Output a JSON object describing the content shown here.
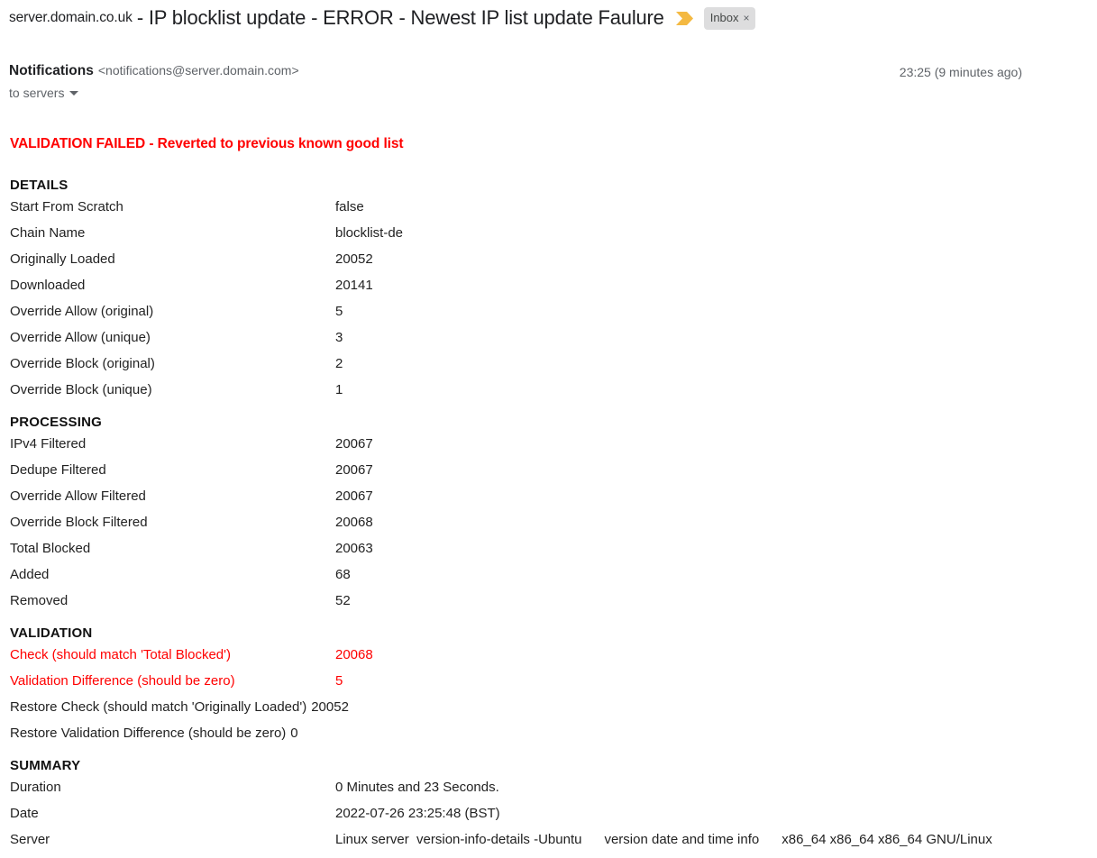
{
  "subject": {
    "sender_domain": "server.domain.co.uk",
    "title": "- IP blocklist update - ERROR - Newest IP list update Faulure",
    "flag_icon": "flag-icon",
    "label_chip": "Inbox",
    "label_chip_close": "×"
  },
  "header": {
    "sender_name": "Notifications",
    "sender_email": "<notifications@server.domain.com>",
    "timestamp": "23:25 (9 minutes ago)",
    "recipient": "to servers",
    "recipient_caret": "chevron-down-icon"
  },
  "body": {
    "alert": "VALIDATION FAILED - Reverted to previous known good list",
    "sections": [
      {
        "title": "DETAILS",
        "rows": [
          {
            "label": "Start From Scratch",
            "value": "false",
            "error": false
          },
          {
            "label": "Chain Name",
            "value": "blocklist-de",
            "error": false
          },
          {
            "label": "Originally Loaded",
            "value": "20052",
            "error": false
          },
          {
            "label": "Downloaded",
            "value": "20141",
            "error": false
          },
          {
            "label": "Override Allow (original)",
            "value": "5",
            "error": false
          },
          {
            "label": "Override Allow (unique)",
            "value": "3",
            "error": false
          },
          {
            "label": "Override Block (original)",
            "value": "2",
            "error": false
          },
          {
            "label": "Override Block (unique)",
            "value": "1",
            "error": false
          }
        ]
      },
      {
        "title": "PROCESSING",
        "rows": [
          {
            "label": "IPv4 Filtered",
            "value": "20067",
            "error": false
          },
          {
            "label": "Dedupe Filtered",
            "value": "20067",
            "error": false
          },
          {
            "label": "Override Allow Filtered",
            "value": "20067",
            "error": false
          },
          {
            "label": "Override Block Filtered",
            "value": "20068",
            "error": false
          },
          {
            "label": "Total Blocked",
            "value": "20063",
            "error": false
          },
          {
            "label": "Added",
            "value": "68",
            "error": false
          },
          {
            "label": "Removed",
            "value": "52",
            "error": false
          }
        ]
      },
      {
        "title": "VALIDATION",
        "rows": [
          {
            "label": "Check (should match 'Total Blocked')",
            "value": "20068",
            "error": true
          },
          {
            "label": "Validation Difference (should be zero)",
            "value": "5",
            "error": true
          },
          {
            "label": "Restore Check (should match 'Originally Loaded')",
            "value": "20052",
            "error": false,
            "tight": true
          },
          {
            "label": "Restore Validation Difference (should be zero)",
            "value": "0",
            "error": false,
            "tight": true
          }
        ]
      },
      {
        "title": "SUMMARY",
        "rows": [
          {
            "label": "Duration",
            "value": "0 Minutes and 23 Seconds.",
            "error": false
          },
          {
            "label": "Date",
            "value": "2022-07-26 23:25:48 (BST)",
            "error": false
          },
          {
            "label": "Server",
            "value": "Linux server  version-info-details -Ubuntu      version date and time info      x86_64 x86_64 x86_64 GNU/Linux",
            "error": false
          }
        ]
      }
    ]
  },
  "colors": {
    "error_red": "#ff0000",
    "flag_yellow": "#f4b942",
    "chip_bg": "#ddddde",
    "text": "#222222",
    "muted": "#5f6368"
  }
}
